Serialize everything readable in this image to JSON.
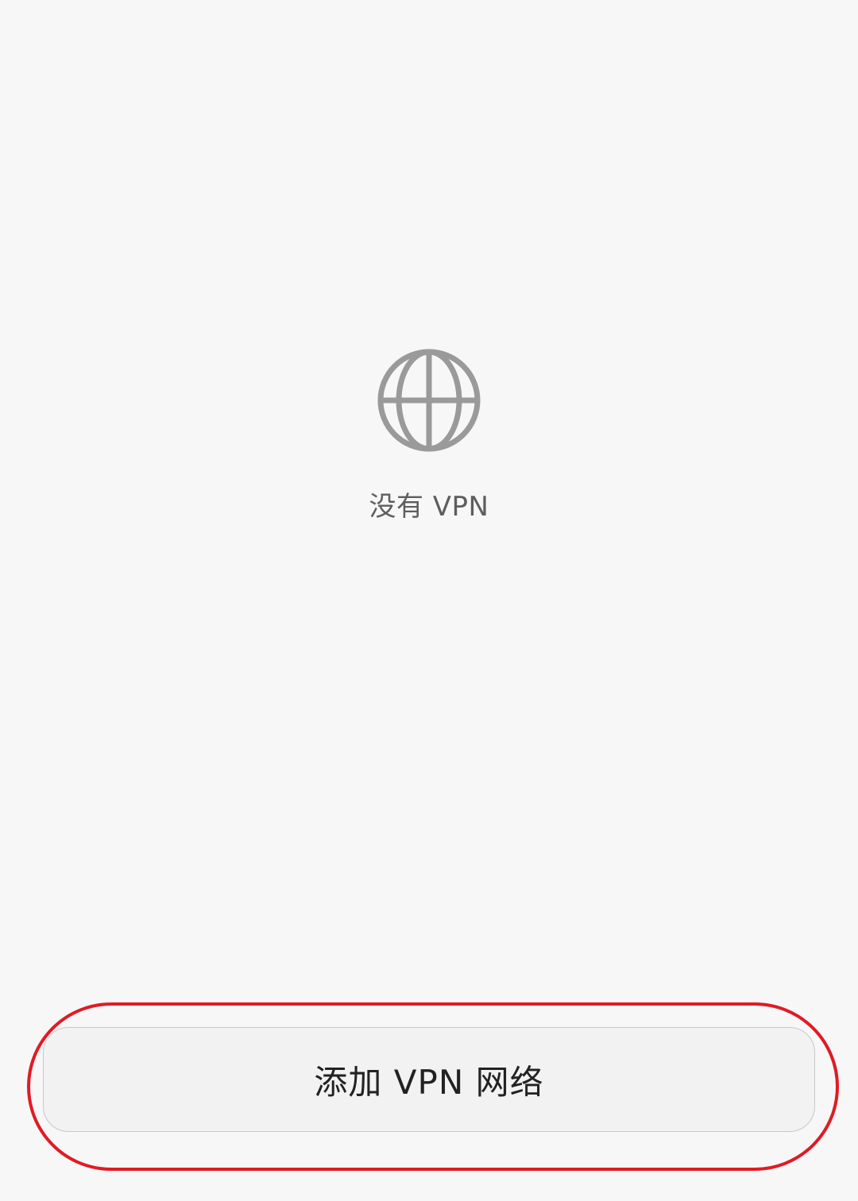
{
  "empty_state": {
    "icon": "globe-icon",
    "icon_color": "#9a9a9a",
    "message": "没有 VPN"
  },
  "add_button": {
    "label": "添加 VPN 网络"
  },
  "annotation": {
    "highlight_color": "#e01b24"
  }
}
